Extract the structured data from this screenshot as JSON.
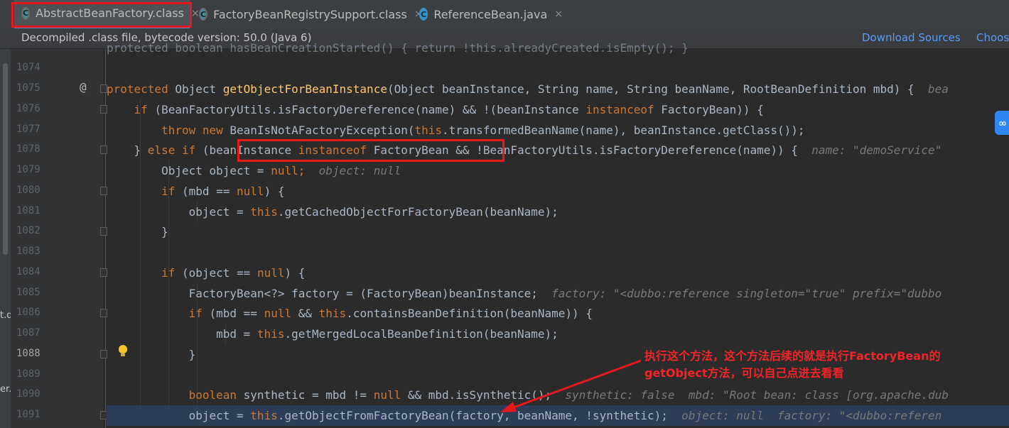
{
  "tabs": [
    {
      "label": "AbstractBeanFactory.class",
      "icon": "class-file-icon"
    },
    {
      "label": "FactoryBeanRegistrySupport.class",
      "icon": "class-file-icon"
    },
    {
      "label": "ReferenceBean.java",
      "icon": "java-class-icon"
    }
  ],
  "tab_close": "×",
  "icon_glyph": "C",
  "banner": {
    "message": "Decompiled .class file, bytecode version: 50.0 (Java 6)",
    "download_sources": "Download Sources",
    "choose_sources": "Choos"
  },
  "left_fragments": [
    "t.de",
    "er."
  ],
  "gutter": {
    "line_numbers": [
      "1074",
      "1075",
      "1076",
      "1077",
      "1078",
      "1079",
      "1080",
      "1081",
      "1082",
      "1083",
      "1084",
      "1085",
      "1086",
      "1087",
      "1088",
      "1089",
      "1090",
      "1091"
    ],
    "current_line": "1088",
    "override_marker": "@"
  },
  "code": {
    "first_line": "protected boolean hasBeanCreationStarted() { return !this.alreadyCreated.isEmpty(); }",
    "l1075_a": "protected ",
    "l1075_b": "Object ",
    "l1075_c": "getObjectForBeanInstance",
    "l1075_d": "(Object beanInstance, String name, String beanName, RootBeanDefinition mbd) {  ",
    "l1075_hint": "bea",
    "l1076_a": "    if ",
    "l1076_b": "(BeanFactoryUtils.isFactoryDereference(name) && !(beanInstance ",
    "l1076_c": "instanceof ",
    "l1076_d": "FactoryBean)) {",
    "l1077_a": "        throw new ",
    "l1077_b": "BeanIsNotAFactoryException(",
    "l1077_c": "this",
    "l1077_d": ".transformedBeanName(name), beanInstance.getClass());",
    "l1078_a": "    } ",
    "l1078_b": "else if ",
    "l1078_c": "(beanInstance ",
    "l1078_d": "instanceof ",
    "l1078_e": "FactoryBean && !BeanFactoryUtils.isFactoryDereference(name)) {  ",
    "l1078_hint": "name: \"demoService\"",
    "l1079_a": "        Object object = ",
    "l1079_b": "null",
    "l1079_c": ";  ",
    "l1079_hint": "object: null",
    "l1080_a": "        if ",
    "l1080_b": "(mbd == ",
    "l1080_c": "null",
    "l1080_d": ") {",
    "l1081_a": "            object = ",
    "l1081_b": "this",
    "l1081_c": ".getCachedObjectForFactoryBean(beanName);",
    "l1082": "        }",
    "l1084_a": "        if ",
    "l1084_b": "(object == ",
    "l1084_c": "null",
    "l1084_d": ") {",
    "l1085_a": "            FactoryBean<?> factory = (FactoryBean)beanInstance;  ",
    "l1085_hint": "factory: \"<dubbo:reference singleton=\"true\" prefix=\"dubbo",
    "l1086_a": "            if ",
    "l1086_b": "(mbd == ",
    "l1086_c": "null ",
    "l1086_d": "&& ",
    "l1086_e": "this",
    "l1086_f": ".containsBeanDefinition(beanName)) {",
    "l1087_a": "                mbd = ",
    "l1087_b": "this",
    "l1087_c": ".getMergedLocalBeanDefinition(beanName);",
    "l1088": "            }",
    "l1090_a": "            boolean ",
    "l1090_b": "synthetic = mbd != ",
    "l1090_c": "null ",
    "l1090_d": "&& mbd.isSynthetic();  ",
    "l1090_hint": "synthetic: false  mbd: \"Root bean: class [org.apache.dub",
    "l1091_a": "            object = ",
    "l1091_b": "this",
    "l1091_c": ".getObjectFromFactoryBean(factory, beanName, !synthetic);  ",
    "l1091_hint": "object: null  factory: \"<dubbo:referen"
  },
  "annotation": {
    "line1": "执行这个方法，这个方法后续的就是执行FactoryBean的",
    "line2": "getObject方法，可以自己点进去看看"
  },
  "colors": {
    "keyword": "#cc7832",
    "method": "#ffc66d",
    "text": "#a9b7c6",
    "hint": "#787878",
    "highlight_box": "#e8171c",
    "link": "#589df6"
  }
}
